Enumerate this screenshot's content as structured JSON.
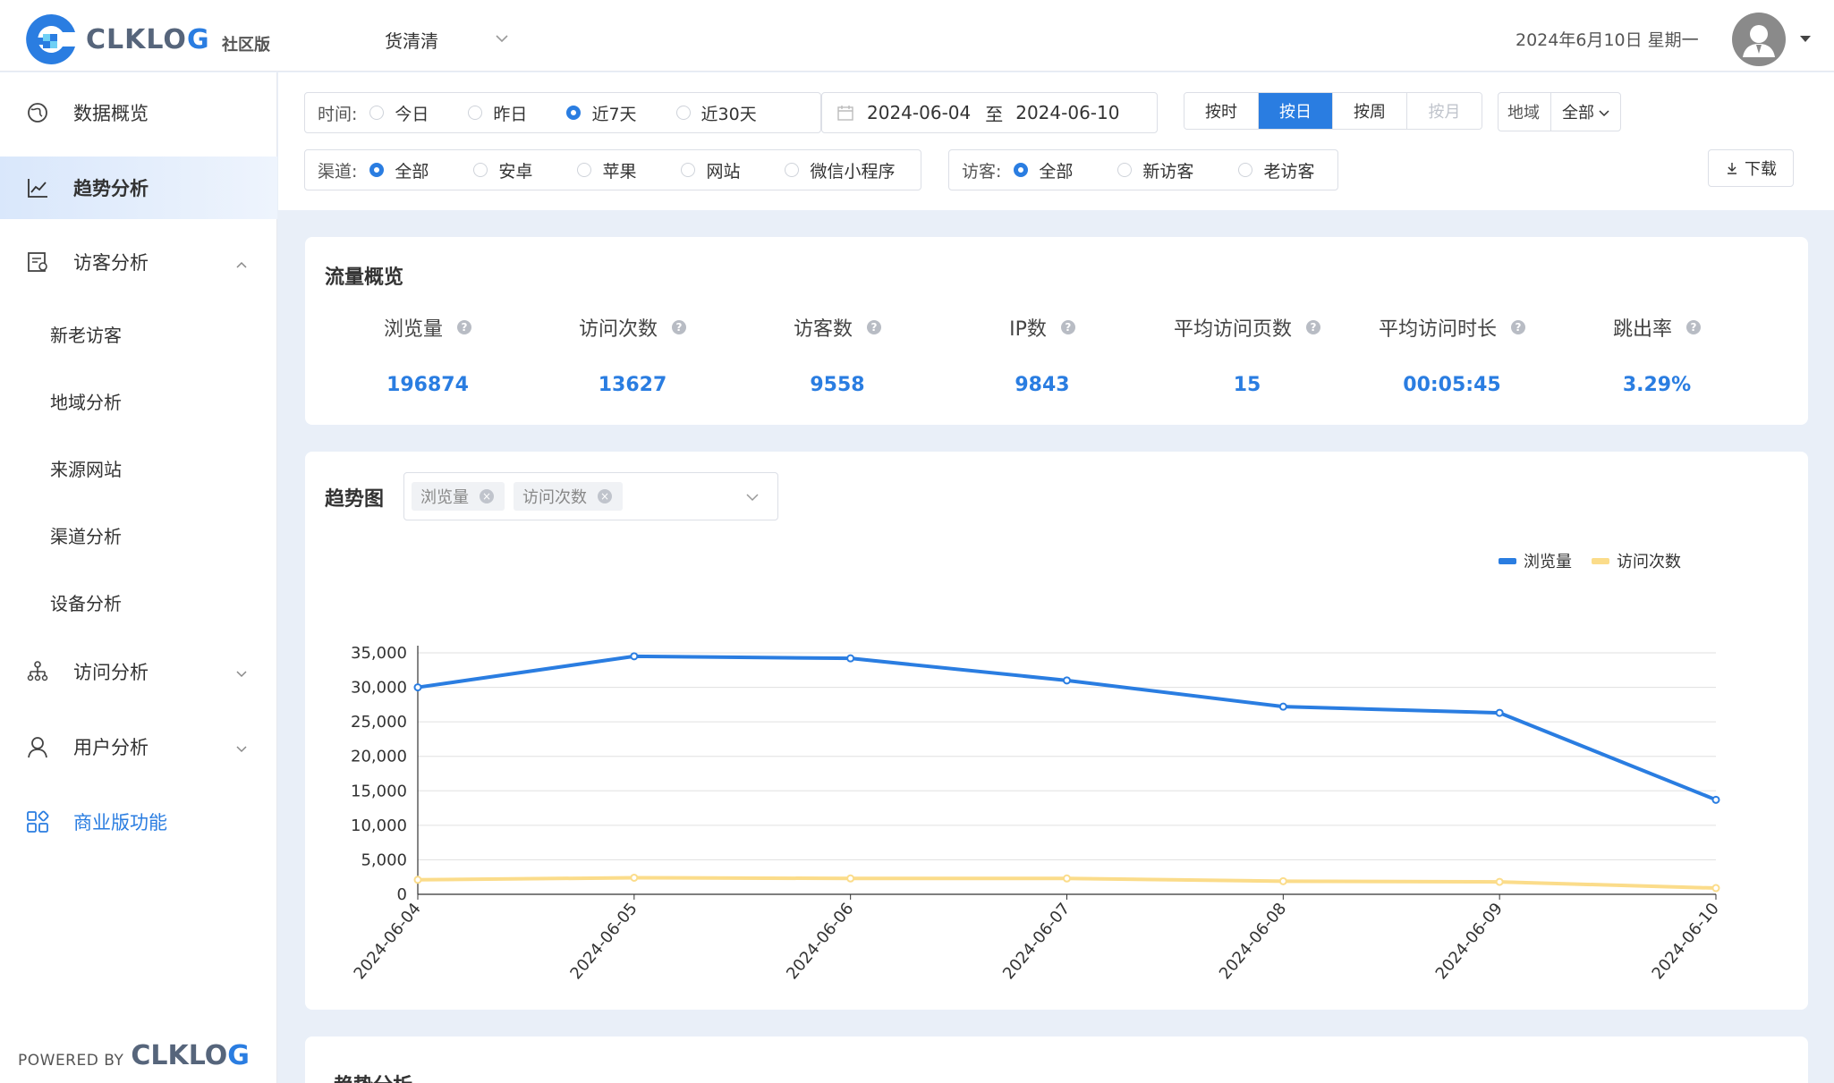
{
  "header": {
    "logo_text_a": "CLKLO",
    "logo_text_b": "G",
    "edition": "社区版",
    "project": "货清清",
    "current_date": "2024年6月10日 星期一"
  },
  "sidebar": {
    "items": [
      {
        "label": "数据概览"
      },
      {
        "label": "趋势分析"
      },
      {
        "label": "访客分析"
      },
      {
        "label": "访问分析"
      },
      {
        "label": "用户分析"
      },
      {
        "label": "商业版功能"
      }
    ],
    "visitor_sub": [
      "新老访客",
      "地域分析",
      "来源网站",
      "渠道分析",
      "设备分析"
    ],
    "powered_by": "POWERED BY",
    "powered_logo_a": "CLKLO",
    "powered_logo_b": "G"
  },
  "filters": {
    "time_label": "时间:",
    "time_options": [
      "今日",
      "昨日",
      "近7天",
      "近30天"
    ],
    "time_selected": "近7天",
    "date_start": "2024-06-04",
    "date_sep": "至",
    "date_end": "2024-06-10",
    "granularity": [
      "按时",
      "按日",
      "按周",
      "按月"
    ],
    "granularity_selected": "按日",
    "region_label": "地域",
    "region_value": "全部",
    "channel_label": "渠道:",
    "channel_options": [
      "全部",
      "安卓",
      "苹果",
      "网站",
      "微信小程序"
    ],
    "visitor_label": "访客:",
    "visitor_options": [
      "全部",
      "新访客",
      "老访客"
    ],
    "download": "下载"
  },
  "overview": {
    "title": "流量概览",
    "metrics": [
      {
        "label": "浏览量",
        "value": "196874"
      },
      {
        "label": "访问次数",
        "value": "13627"
      },
      {
        "label": "访客数",
        "value": "9558"
      },
      {
        "label": "IP数",
        "value": "9843"
      },
      {
        "label": "平均访问页数",
        "value": "15"
      },
      {
        "label": "平均访问时长",
        "value": "00:05:45"
      },
      {
        "label": "跳出率",
        "value": "3.29%"
      }
    ]
  },
  "trend": {
    "title": "趋势图",
    "selected_tags": [
      "浏览量",
      "访问次数"
    ]
  },
  "analysis": {
    "title": "趋势分析"
  },
  "colors": {
    "accent": "#2a7de1",
    "series_pv": "#2a7de1",
    "series_visits": "#fbdc8a"
  },
  "chart_data": {
    "type": "line",
    "x": [
      "2024-06-04",
      "2024-06-05",
      "2024-06-06",
      "2024-06-07",
      "2024-06-08",
      "2024-06-09",
      "2024-06-10"
    ],
    "series": [
      {
        "name": "浏览量",
        "values": [
          30000,
          34500,
          34200,
          31000,
          27200,
          26300,
          13700
        ]
      },
      {
        "name": "访问次数",
        "values": [
          2100,
          2400,
          2300,
          2300,
          1900,
          1800,
          900
        ]
      }
    ],
    "yticks": [
      "0",
      "5,000",
      "10,000",
      "15,000",
      "20,000",
      "25,000",
      "30,000",
      "35,000"
    ],
    "ylim": [
      0,
      35000
    ],
    "grid": true,
    "legend_position": "top-right"
  }
}
